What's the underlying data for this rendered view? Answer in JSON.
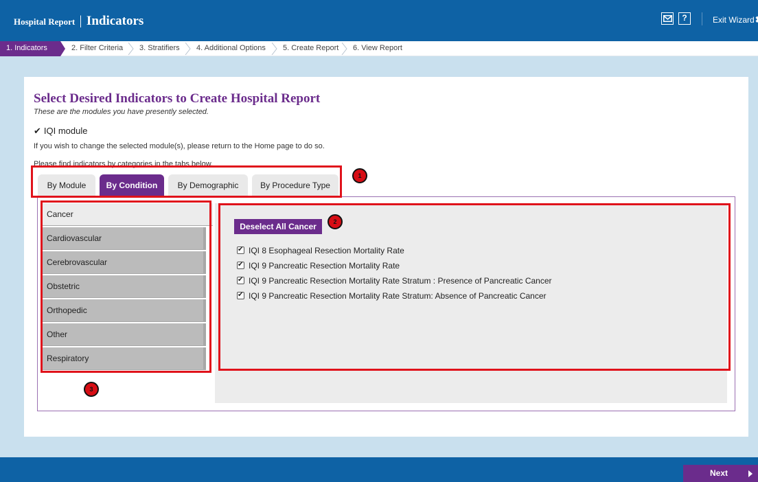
{
  "header": {
    "title_small": "Hospital Report",
    "title_sep": "|",
    "title_big": "Indicators",
    "mail_icon": "envelope-icon",
    "help_label": "?",
    "exit_label": "Exit Wizard",
    "exit_icon": "✖"
  },
  "steps": [
    {
      "label": "1. Indicators",
      "active": true
    },
    {
      "label": "2. Filter Criteria",
      "active": false
    },
    {
      "label": "3. Stratifiers",
      "active": false
    },
    {
      "label": "4. Additional Options",
      "active": false
    },
    {
      "label": "5. Create Report",
      "active": false
    },
    {
      "label": "6. View Report",
      "active": false
    }
  ],
  "main": {
    "heading": "Select Desired Indicators to Create Hospital Report",
    "subheading": "These are the modules you have presently selected.",
    "module_check": "✔",
    "module_label": "IQI module",
    "change_note": "If you wish to change the selected module(s), please return to the Home page to do so.",
    "tabs_note": "Please find indicators by categories in the tabs below."
  },
  "tabs": [
    {
      "label": "By Module",
      "active": false
    },
    {
      "label": "By Condition",
      "active": true
    },
    {
      "label": "By Demographic",
      "active": false
    },
    {
      "label": "By Procedure Type",
      "active": false
    }
  ],
  "categories": [
    {
      "label": "Cancer",
      "active": true
    },
    {
      "label": "Cardiovascular",
      "active": false
    },
    {
      "label": "Cerebrovascular",
      "active": false
    },
    {
      "label": "Obstetric",
      "active": false
    },
    {
      "label": "Orthopedic",
      "active": false
    },
    {
      "label": "Other",
      "active": false
    },
    {
      "label": "Respiratory",
      "active": false
    }
  ],
  "deselect_label": "Deselect All Cancer",
  "indicators": [
    {
      "label": "IQI 8 Esophageal Resection Mortality Rate",
      "checked": true
    },
    {
      "label": "IQI 9 Pancreatic Resection Mortality Rate",
      "checked": true
    },
    {
      "label": "IQI 9 Pancreatic Resection Mortality Rate Stratum : Presence of Pancreatic Cancer",
      "checked": true
    },
    {
      "label": "IQI 9 Pancreatic Resection Mortality Rate Stratum: Absence of Pancreatic Cancer",
      "checked": true
    }
  ],
  "annotations": [
    "1",
    "2",
    "3"
  ],
  "footer": {
    "next_label": "Next"
  },
  "colors": {
    "primary_blue": "#0e62a5",
    "accent_purple": "#6b2c8c",
    "page_bg": "#c9e0ee",
    "annotation_red": "#e0121b"
  }
}
